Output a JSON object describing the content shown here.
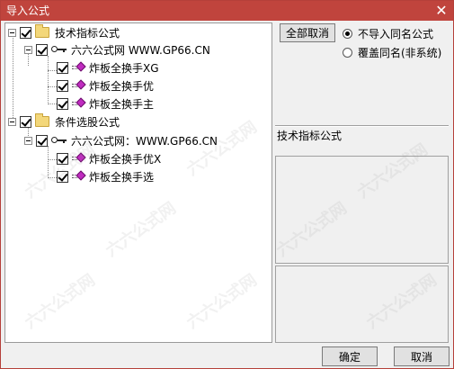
{
  "window": {
    "title": "导入公式",
    "close_glyph": "✕"
  },
  "tree": {
    "groups": [
      {
        "label": "技术指标公式",
        "source": "六六公式网 WWW.GP66.CN",
        "items": [
          "炸板全换手XG",
          "炸板全换手优",
          "炸板全换手主"
        ]
      },
      {
        "label": "条件选股公式",
        "source": "六六公式网：WWW.GP66.CN",
        "items": [
          "炸板全换手优X",
          "炸板全换手选"
        ]
      }
    ]
  },
  "right_panel": {
    "cancel_all_label": "全部取消",
    "radio_options": [
      "不导入同名公式",
      "覆盖同名(非系统)"
    ],
    "selected_radio_index": 0,
    "section_label": "技术指标公式"
  },
  "footer": {
    "ok_label": "确定",
    "cancel_label": "取消"
  },
  "watermark": {
    "text": "六六公式网"
  },
  "colors": {
    "titlebar": "#c0443d",
    "formula_icon": "#c02cc0",
    "folder": "#f3d77a"
  }
}
